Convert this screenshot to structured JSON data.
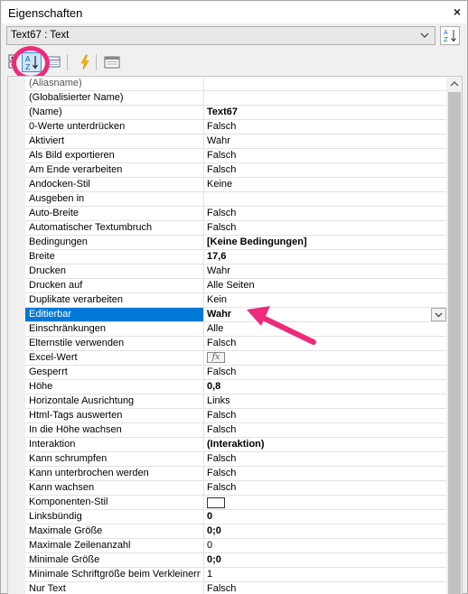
{
  "window": {
    "title": "Eigenschaften",
    "close_label": "×"
  },
  "object_selector": {
    "value": "Text67 : Text"
  },
  "toolbar": {
    "expand_icon": "expand-collapse-icon",
    "sort_alpha_icon": "sort-alphabetical-icon",
    "categorized_icon": "categorized-view-icon",
    "events_icon": "lightning-icon",
    "property_pages_icon": "property-pages-icon"
  },
  "colors": {
    "selection": "#0078d7",
    "annotation": "#ee2a7b",
    "scroll_thumb": "#c1c1c1"
  },
  "properties": [
    {
      "name": "(Aliasname)",
      "value": ""
    },
    {
      "name": "(Globalisierter Name)",
      "value": ""
    },
    {
      "name": "(Name)",
      "value": "Text67",
      "bold": true
    },
    {
      "name": "0-Werte unterdrücken",
      "value": "Falsch"
    },
    {
      "name": "Aktiviert",
      "value": "Wahr"
    },
    {
      "name": "Als Bild exportieren",
      "value": "Falsch"
    },
    {
      "name": "Am Ende verarbeiten",
      "value": "Falsch"
    },
    {
      "name": "Andocken-Stil",
      "value": "Keine"
    },
    {
      "name": "Ausgeben in",
      "value": ""
    },
    {
      "name": "Auto-Breite",
      "value": "Falsch"
    },
    {
      "name": "Automatischer Textumbruch",
      "value": "Falsch"
    },
    {
      "name": "Bedingungen",
      "value": "[Keine Bedingungen]",
      "bold": true
    },
    {
      "name": "Breite",
      "value": "17,6",
      "bold": true
    },
    {
      "name": "Drucken",
      "value": "Wahr"
    },
    {
      "name": "Drucken auf",
      "value": "Alle Seiten"
    },
    {
      "name": "Duplikate verarbeiten",
      "value": "Kein"
    },
    {
      "name": "Editierbar",
      "value": "Wahr",
      "selected": true
    },
    {
      "name": "Einschränkungen",
      "value": "Alle"
    },
    {
      "name": "Elternstile verwenden",
      "value": "Falsch"
    },
    {
      "name": "Excel-Wert",
      "value": "fx",
      "widget": "fx"
    },
    {
      "name": "Gesperrt",
      "value": "Falsch"
    },
    {
      "name": "Höhe",
      "value": "0,8",
      "bold": true
    },
    {
      "name": "Horizontale Ausrichtung",
      "value": "Links"
    },
    {
      "name": "Html-Tags auswerten",
      "value": "Falsch"
    },
    {
      "name": "In die Höhe wachsen",
      "value": "Falsch"
    },
    {
      "name": "Interaktion",
      "value": "(Interaktion)",
      "bold": true
    },
    {
      "name": "Kann schrumpfen",
      "value": "Falsch"
    },
    {
      "name": "Kann unterbrochen werden",
      "value": "Falsch"
    },
    {
      "name": "Kann wachsen",
      "value": "Falsch"
    },
    {
      "name": "Komponenten-Stil",
      "value": "",
      "widget": "swatch"
    },
    {
      "name": "Linksbündig",
      "value": "0",
      "bold": true
    },
    {
      "name": "Maximale Größe",
      "value": "0;0",
      "bold": true
    },
    {
      "name": "Maximale Zeilenanzahl",
      "value": "0"
    },
    {
      "name": "Minimale Größe",
      "value": "0;0",
      "bold": true
    },
    {
      "name": "Minimale Schriftgröße beim Verkleinern",
      "value": "1"
    },
    {
      "name": "Nur Text",
      "value": "Falsch"
    }
  ]
}
